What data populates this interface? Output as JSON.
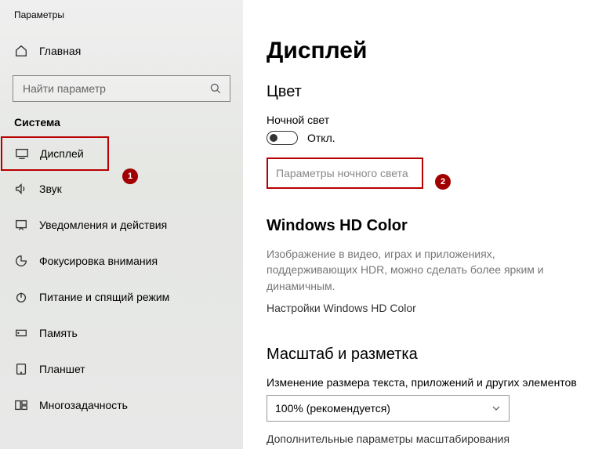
{
  "window_title": "Параметры",
  "home_label": "Главная",
  "search_placeholder": "Найти параметр",
  "section_label": "Система",
  "nav": {
    "display": "Дисплей",
    "sound": "Звук",
    "notifications": "Уведомления и действия",
    "focus": "Фокусировка внимания",
    "power": "Питание и спящий режим",
    "storage": "Память",
    "tablet": "Планшет",
    "multitask": "Многозадачность"
  },
  "annotation": {
    "badge1": "1",
    "badge2": "2"
  },
  "main": {
    "title": "Дисплей",
    "color_heading": "Цвет",
    "night_light_label": "Ночной свет",
    "toggle_state": "Откл.",
    "night_light_settings": "Параметры ночного света",
    "hd_heading": "Windows HD Color",
    "hd_desc": "Изображение в видео, играх и приложениях, поддерживающих HDR, можно сделать более ярким и динамичным.",
    "hd_link": "Настройки Windows HD Color",
    "scale_heading": "Масштаб и разметка",
    "scale_label": "Изменение размера текста, приложений и других элементов",
    "scale_value": "100% (рекомендуется)",
    "advanced_scaling": "Дополнительные параметры масштабирования"
  }
}
